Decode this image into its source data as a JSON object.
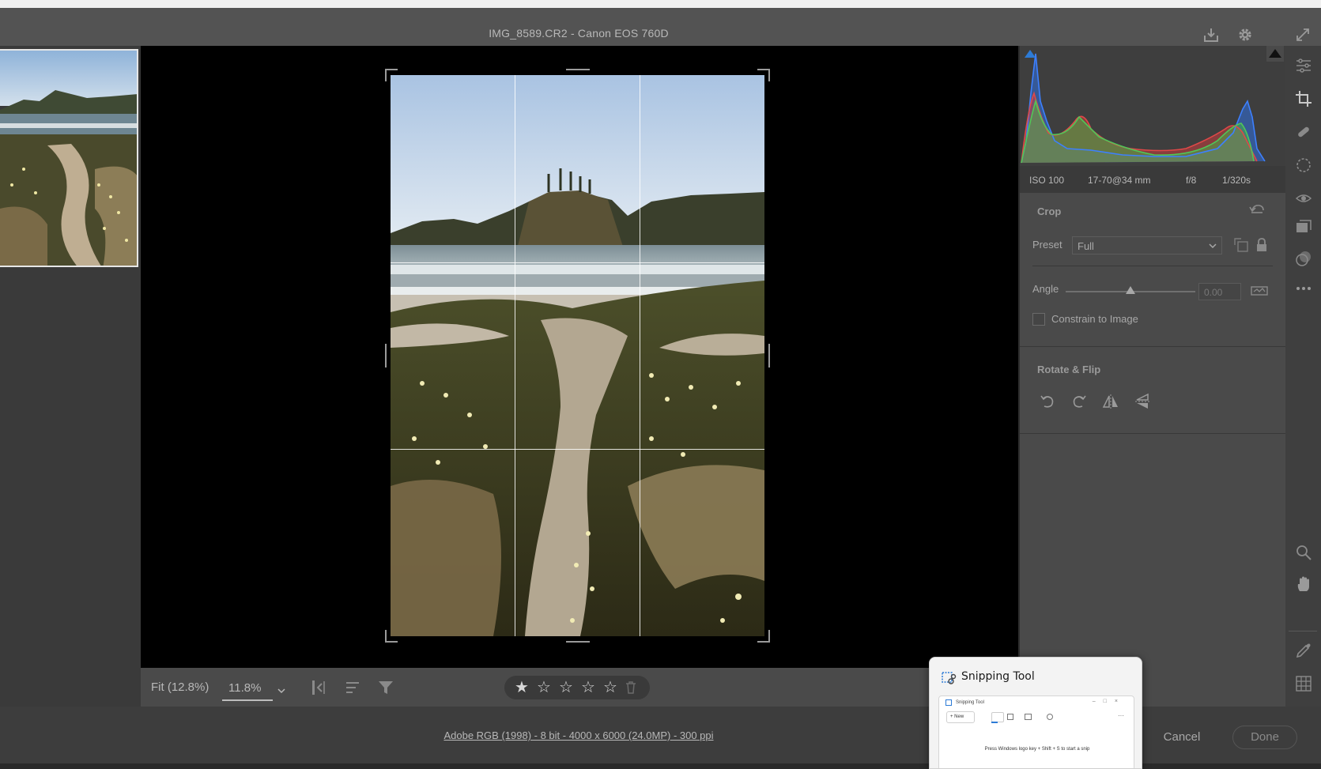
{
  "window": {
    "title": "IMG_8589.CR2  -  Canon EOS 760D",
    "open_image_label": "open-image",
    "settings_label": "preferences",
    "fullscreen_label": "fullscreen"
  },
  "exif": {
    "iso": "ISO 100",
    "lens": "17-70@34 mm",
    "aperture": "f/8",
    "shutter": "1/320s"
  },
  "crop_panel": {
    "title": "Crop",
    "preset_label": "Preset",
    "preset_value": "Full",
    "angle_label": "Angle",
    "angle_value": "0.00",
    "angle_slider_fraction": 0.5,
    "constrain_label": "Constrain to Image",
    "constrain_checked": false
  },
  "rotate_panel": {
    "title": "Rotate & Flip"
  },
  "status_bar": {
    "zoom_fit": "Fit (12.8%)",
    "zoom_value": "11.8%",
    "rating_stars": 5,
    "rating_value": 1
  },
  "footer": {
    "workflow": "Adobe RGB (1998) - 8 bit - 4000 x 6000 (24.0MP) - 300 ppi",
    "cancel": "Cancel",
    "done": "Done"
  },
  "snipping_tool": {
    "title": "Snipping Tool",
    "preview_title": "Snipping Tool",
    "preview_new": "New",
    "preview_message": "Press Windows logo key + Shift + S to start a snip"
  },
  "colors": {
    "accent_blue": "#2d7bd6",
    "histogram_red": "#d43c3c",
    "histogram_green": "#43b54a",
    "histogram_blue": "#2f6fe0"
  }
}
